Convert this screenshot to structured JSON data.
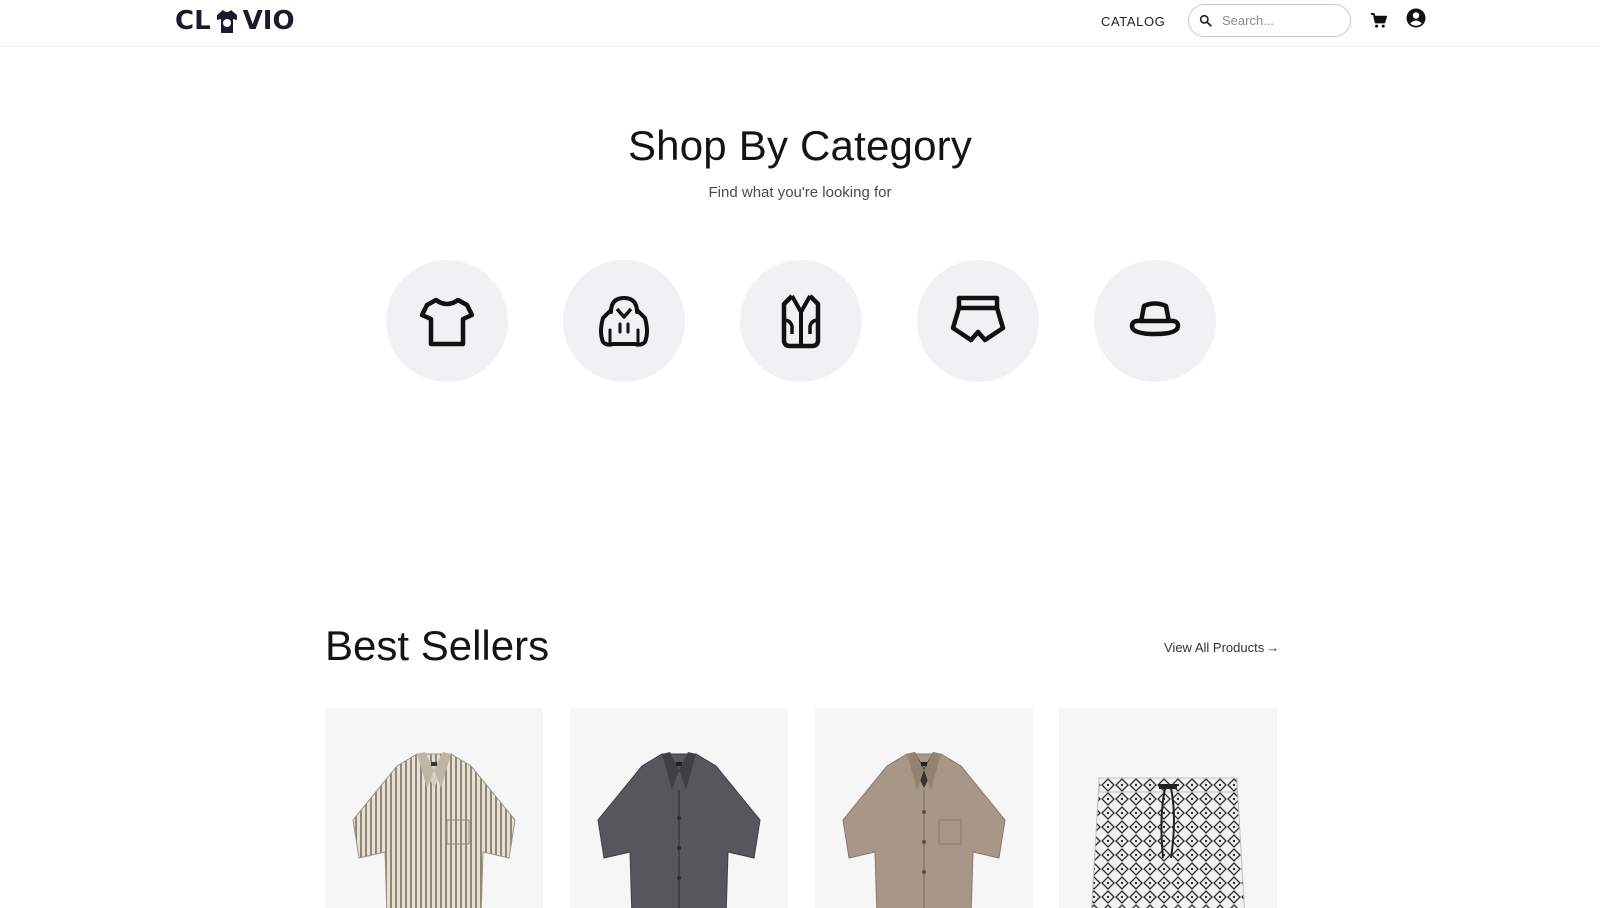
{
  "brand": {
    "logo_left": "CL",
    "logo_right": "VIO"
  },
  "header": {
    "nav": {
      "catalog": "CATALOG"
    },
    "search": {
      "placeholder": "Search..."
    },
    "icons": {
      "search": "search-icon",
      "cart": "cart-icon",
      "account": "user-circle-icon"
    }
  },
  "categories": {
    "title": "Shop By Category",
    "subtitle": "Find what you're looking for",
    "items": [
      {
        "icon": "tshirt-icon"
      },
      {
        "icon": "hoodie-icon"
      },
      {
        "icon": "vest-icon"
      },
      {
        "icon": "shorts-icon"
      },
      {
        "icon": "bucket-hat-icon"
      }
    ]
  },
  "best_sellers": {
    "title": "Best Sellers",
    "view_all": "View All Products",
    "view_all_arrow": "→",
    "products": [
      {
        "image": "striped-camp-shirt",
        "color": "#cfc9bb"
      },
      {
        "image": "dark-grey-camp-shirt",
        "color": "#505056"
      },
      {
        "image": "taupe-camp-shirt",
        "color": "#a69584"
      },
      {
        "image": "patterned-swim-shorts",
        "color": "#e9e9e9"
      }
    ]
  },
  "colors": {
    "accent": "#1d1a2e",
    "circle_bg": "#f0f1f3",
    "card_bg": "#f6f6f6"
  }
}
